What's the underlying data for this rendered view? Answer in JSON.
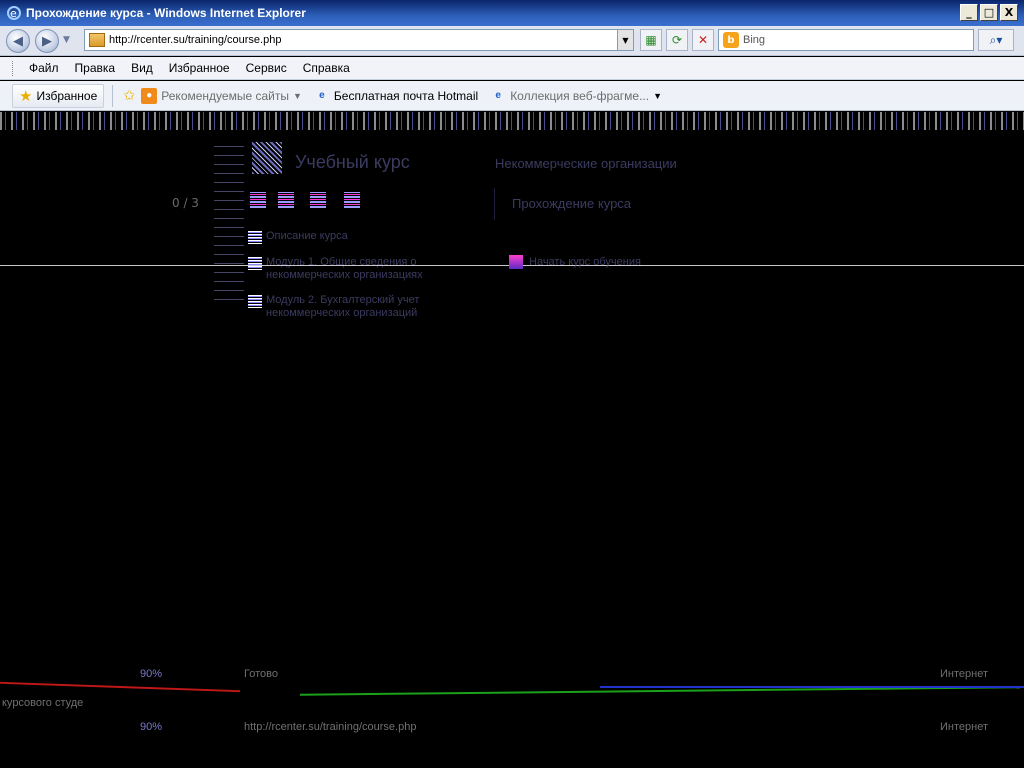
{
  "window": {
    "title": "Прохождение курса - Windows Internet Explorer",
    "controls": {
      "minimize": "_",
      "maximize": "□",
      "close": "X"
    }
  },
  "navbar": {
    "url": "http://rcenter.su/training/course.php",
    "search_placeholder": "Bing",
    "icons": [
      "back-icon",
      "forward-icon",
      "compat-icon",
      "refresh-icon",
      "stop-icon",
      "search-icon"
    ]
  },
  "menu": {
    "items": [
      "Файл",
      "Правка",
      "Вид",
      "Избранное",
      "Сервис",
      "Справка"
    ]
  },
  "favorites": {
    "button_label": "Избранное",
    "items": [
      {
        "label": "Рекомендуемые сайты",
        "has_dropdown": true
      },
      {
        "label": "Бесплатная почта Hotmail",
        "has_dropdown": false
      },
      {
        "label": "Коллекция веб-фрагме...",
        "has_dropdown": true
      }
    ]
  },
  "page": {
    "logo_text": "Учебный курс",
    "org_name": "Некоммерческие организации",
    "counter": "0 / 3",
    "heading": "Прохождение курса",
    "nav_items": [
      "Описание курса",
      "Модуль 1. Общие сведения о некоммерческих организациях",
      "Модуль 2. Бухгалтерский учет некоммерческих организаций"
    ],
    "start_link": "Начать курс обучения"
  },
  "status_ghost": {
    "zoom": "90%",
    "ready": "Готово",
    "zone": "Интернет",
    "url_ghost": "http://rcenter.su/training/course.php",
    "left_fragment": "курсового студе"
  },
  "colors": {
    "titlebar": "#0a246a",
    "page_bg": "#000000",
    "favorites_bar": "#eef1f7"
  }
}
